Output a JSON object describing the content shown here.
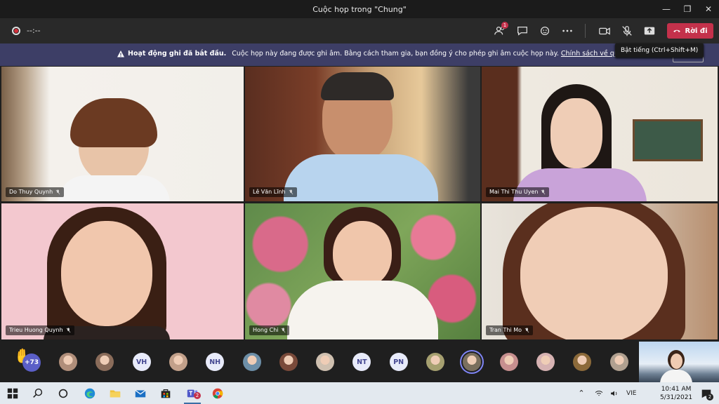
{
  "window": {
    "title": "Cuộc họp trong \"Chung\""
  },
  "toolbar": {
    "timer": "--:--",
    "participants_badge": "1",
    "leave_label": "Rời đi"
  },
  "banner": {
    "heading": "Hoạt động ghi đã bắt đầu.",
    "message": "Cuộc họp này đang được ghi âm. Bằng cách tham gia, bạn đồng ý cho phép ghi âm cuộc họp này.",
    "link": "Chính sách về quyền riêng tư",
    "dismiss_label": "Bỏ"
  },
  "tooltip": "Bật tiếng (Ctrl+Shift+M)",
  "participants": [
    {
      "name": "Do Thuy Quynh"
    },
    {
      "name": "Lê Văn Lĩnh"
    },
    {
      "name": "Mai Thi Thu Uyen"
    },
    {
      "name": "Trieu Huong Quynh"
    },
    {
      "name": "Hong Chi"
    },
    {
      "name": "Tran Thi Mo"
    }
  ],
  "strip": {
    "more_count": "+73",
    "avatars": [
      {
        "type": "photo",
        "color": "#b08e7a"
      },
      {
        "type": "photo",
        "color": "#8a6c5a"
      },
      {
        "type": "initials",
        "text": "VH"
      },
      {
        "type": "photo",
        "color": "#c2a08a"
      },
      {
        "type": "initials",
        "text": "NH"
      },
      {
        "type": "photo",
        "color": "#6d8fa8"
      },
      {
        "type": "photo",
        "color": "#7a4a3a"
      },
      {
        "type": "photo",
        "color": "#cfc0b0"
      },
      {
        "type": "initials",
        "text": "NT"
      },
      {
        "type": "initials",
        "text": "PN"
      },
      {
        "type": "photo",
        "color": "#a6a070"
      },
      {
        "type": "photo",
        "color": "#7a6f5e",
        "active": true
      },
      {
        "type": "photo",
        "color": "#c78f8f"
      },
      {
        "type": "photo",
        "color": "#d6b2b2"
      },
      {
        "type": "photo",
        "color": "#8c6a3a"
      },
      {
        "type": "photo",
        "color": "#b0a090"
      }
    ]
  },
  "taskbar": {
    "teams_badge": "2",
    "lang": "VIE",
    "time": "10:41 AM",
    "date": "5/31/2021",
    "notifications": "2"
  }
}
